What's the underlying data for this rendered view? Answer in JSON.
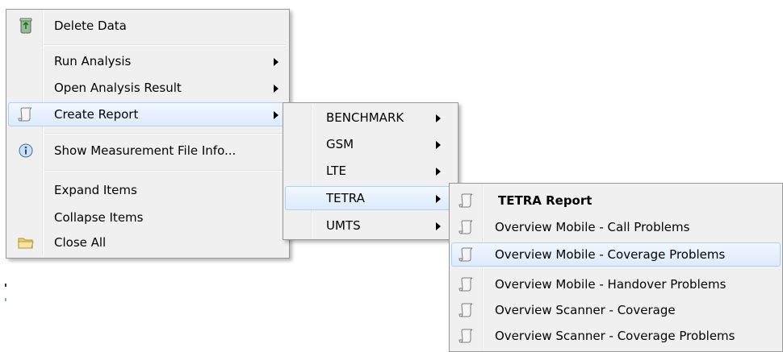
{
  "main_menu": {
    "items": [
      {
        "label": "Delete Data",
        "icon": "recycle-bin-icon",
        "submenu": false
      },
      {
        "label": "Run Analysis",
        "icon": "",
        "submenu": true
      },
      {
        "label": "Open Analysis Result",
        "icon": "",
        "submenu": true
      },
      {
        "label": "Create Report",
        "icon": "report-icon",
        "submenu": true,
        "highlighted": true
      },
      {
        "label": "Show Measurement File Info...",
        "icon": "info-icon",
        "submenu": false
      },
      {
        "label": "Expand Items",
        "icon": "",
        "submenu": false
      },
      {
        "label": "Collapse Items",
        "icon": "",
        "submenu": false
      },
      {
        "label": "Close All",
        "icon": "folder-icon",
        "submenu": false
      }
    ]
  },
  "report_menu": {
    "items": [
      {
        "label": "BENCHMARK",
        "submenu": true
      },
      {
        "label": "GSM",
        "submenu": true
      },
      {
        "label": "LTE",
        "submenu": true
      },
      {
        "label": "TETRA",
        "submenu": true,
        "highlighted": true
      },
      {
        "label": "UMTS",
        "submenu": true
      }
    ]
  },
  "tetra_menu": {
    "items": [
      {
        "label": "TETRA Report",
        "icon": "report-icon",
        "bold": true
      },
      {
        "label": "Overview Mobile - Call Problems",
        "icon": "report-icon"
      },
      {
        "label": "Overview Mobile - Coverage Problems",
        "icon": "report-icon",
        "highlighted": true
      },
      {
        "label": "Overview Mobile - Handover Problems",
        "icon": "report-icon"
      },
      {
        "label": "Overview Scanner - Coverage",
        "icon": "report-icon"
      },
      {
        "label": "Overview Scanner - Coverage Problems",
        "icon": "report-icon"
      }
    ]
  },
  "colors": {
    "menu_bg": "#f0f0f0",
    "highlight_border": "#aecff7",
    "highlight_fill": "#dcebfc"
  }
}
